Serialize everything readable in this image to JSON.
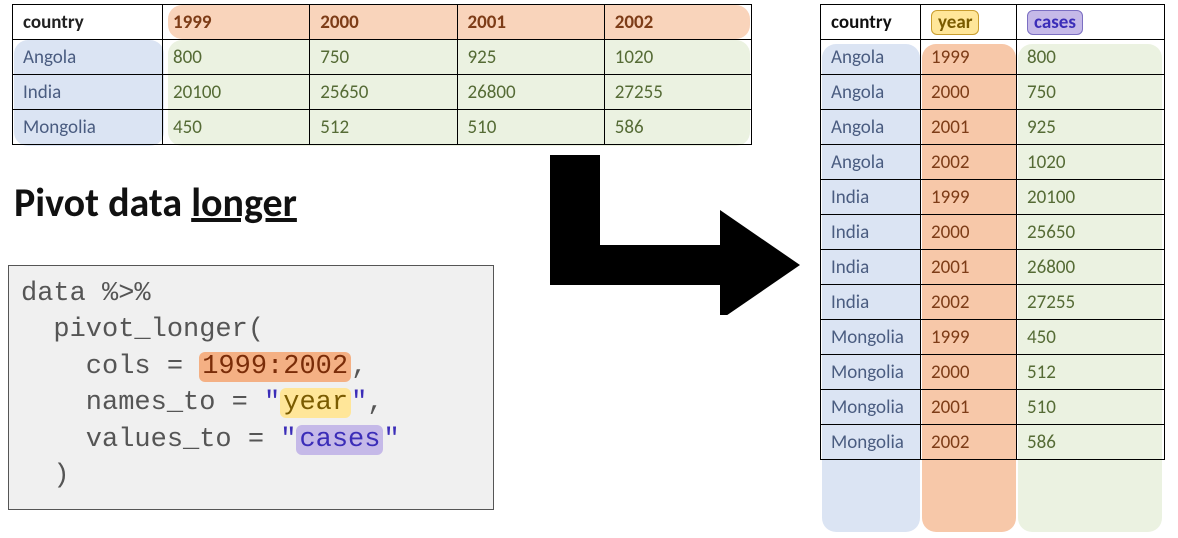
{
  "title_prefix": "Pivot data ",
  "title_underlined": "longer",
  "wide": {
    "header_country": "country",
    "years": [
      "1999",
      "2000",
      "2001",
      "2002"
    ],
    "rows": [
      {
        "country": "Angola",
        "vals": [
          "800",
          "750",
          "925",
          "1020"
        ]
      },
      {
        "country": "India",
        "vals": [
          "20100",
          "25650",
          "26800",
          "27255"
        ]
      },
      {
        "country": "Mongolia",
        "vals": [
          "450",
          "512",
          "510",
          "586"
        ]
      }
    ]
  },
  "code": {
    "l1_a": "data ",
    "l1_b": "%>%",
    "l2": "  pivot_longer(",
    "l3_a": "    cols = ",
    "l3_hi": "1999:2002",
    "l3_b": ",",
    "l4_a": "    names_to = ",
    "l4_q1": "\"",
    "l4_hi": "year",
    "l4_q2": "\"",
    "l4_b": ",",
    "l5_a": "    values_to = ",
    "l5_q1": "\"",
    "l5_hi": "cases",
    "l5_q2": "\"",
    "l6": "  )"
  },
  "long": {
    "header_country": "country",
    "header_year": "year",
    "header_cases": "cases",
    "rows": [
      {
        "country": "Angola",
        "year": "1999",
        "cases": "800"
      },
      {
        "country": "Angola",
        "year": "2000",
        "cases": "750"
      },
      {
        "country": "Angola",
        "year": "2001",
        "cases": "925"
      },
      {
        "country": "Angola",
        "year": "2002",
        "cases": "1020"
      },
      {
        "country": "India",
        "year": "1999",
        "cases": "20100"
      },
      {
        "country": "India",
        "year": "2000",
        "cases": "25650"
      },
      {
        "country": "India",
        "year": "2001",
        "cases": "26800"
      },
      {
        "country": "India",
        "year": "2002",
        "cases": "27255"
      },
      {
        "country": "Mongolia",
        "year": "1999",
        "cases": "450"
      },
      {
        "country": "Mongolia",
        "year": "2000",
        "cases": "512"
      },
      {
        "country": "Mongolia",
        "year": "2001",
        "cases": "510"
      },
      {
        "country": "Mongolia",
        "year": "2002",
        "cases": "586"
      }
    ]
  },
  "chart_data": {
    "type": "table",
    "title": "Pivot data longer",
    "wide": {
      "columns": [
        "country",
        "1999",
        "2000",
        "2001",
        "2002"
      ],
      "data": [
        [
          "Angola",
          800,
          750,
          925,
          1020
        ],
        [
          "India",
          20100,
          25650,
          26800,
          27255
        ],
        [
          "Mongolia",
          450,
          512,
          510,
          586
        ]
      ]
    },
    "long": {
      "columns": [
        "country",
        "year",
        "cases"
      ],
      "data": [
        [
          "Angola",
          1999,
          800
        ],
        [
          "Angola",
          2000,
          750
        ],
        [
          "Angola",
          2001,
          925
        ],
        [
          "Angola",
          2002,
          1020
        ],
        [
          "India",
          1999,
          20100
        ],
        [
          "India",
          2000,
          25650
        ],
        [
          "India",
          2001,
          26800
        ],
        [
          "India",
          2002,
          27255
        ],
        [
          "Mongolia",
          1999,
          450
        ],
        [
          "Mongolia",
          2000,
          512
        ],
        [
          "Mongolia",
          2001,
          510
        ],
        [
          "Mongolia",
          2002,
          586
        ]
      ]
    },
    "code": "data %>%\n  pivot_longer(\n    cols = 1999:2002,\n    names_to = \"year\",\n    values_to = \"cases\"\n  )"
  }
}
